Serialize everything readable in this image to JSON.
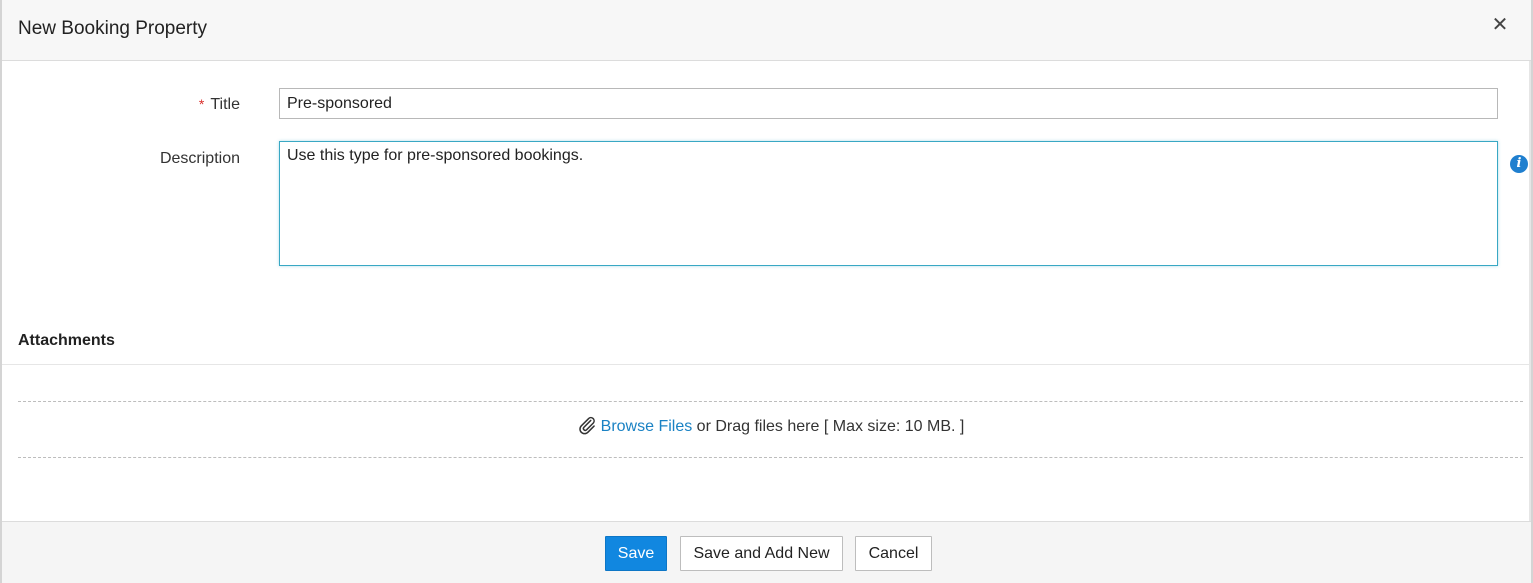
{
  "dialog": {
    "title": "New Booking Property",
    "close_symbol": "✕"
  },
  "form": {
    "title_label": "Title",
    "title_required_mark": "*",
    "title_value": "Pre-sponsored",
    "description_label": "Description",
    "description_value": "Use this type for pre-sponsored bookings. ",
    "info_symbol": "i"
  },
  "attachments": {
    "heading": "Attachments",
    "browse_link": "Browse Files",
    "drag_text": " or Drag files here [ Max size: 10 MB. ]"
  },
  "footer": {
    "save_label": "Save",
    "save_new_label": "Save and Add New",
    "cancel_label": "Cancel"
  },
  "colors": {
    "primary_button": "#1187e0",
    "link": "#1a82c4",
    "required": "#d9302c",
    "focus_border": "#39a8c4",
    "info_icon": "#1f7fcf"
  },
  "icons": {
    "close": "close-icon",
    "info": "info-icon",
    "attachment": "paperclip-icon"
  }
}
